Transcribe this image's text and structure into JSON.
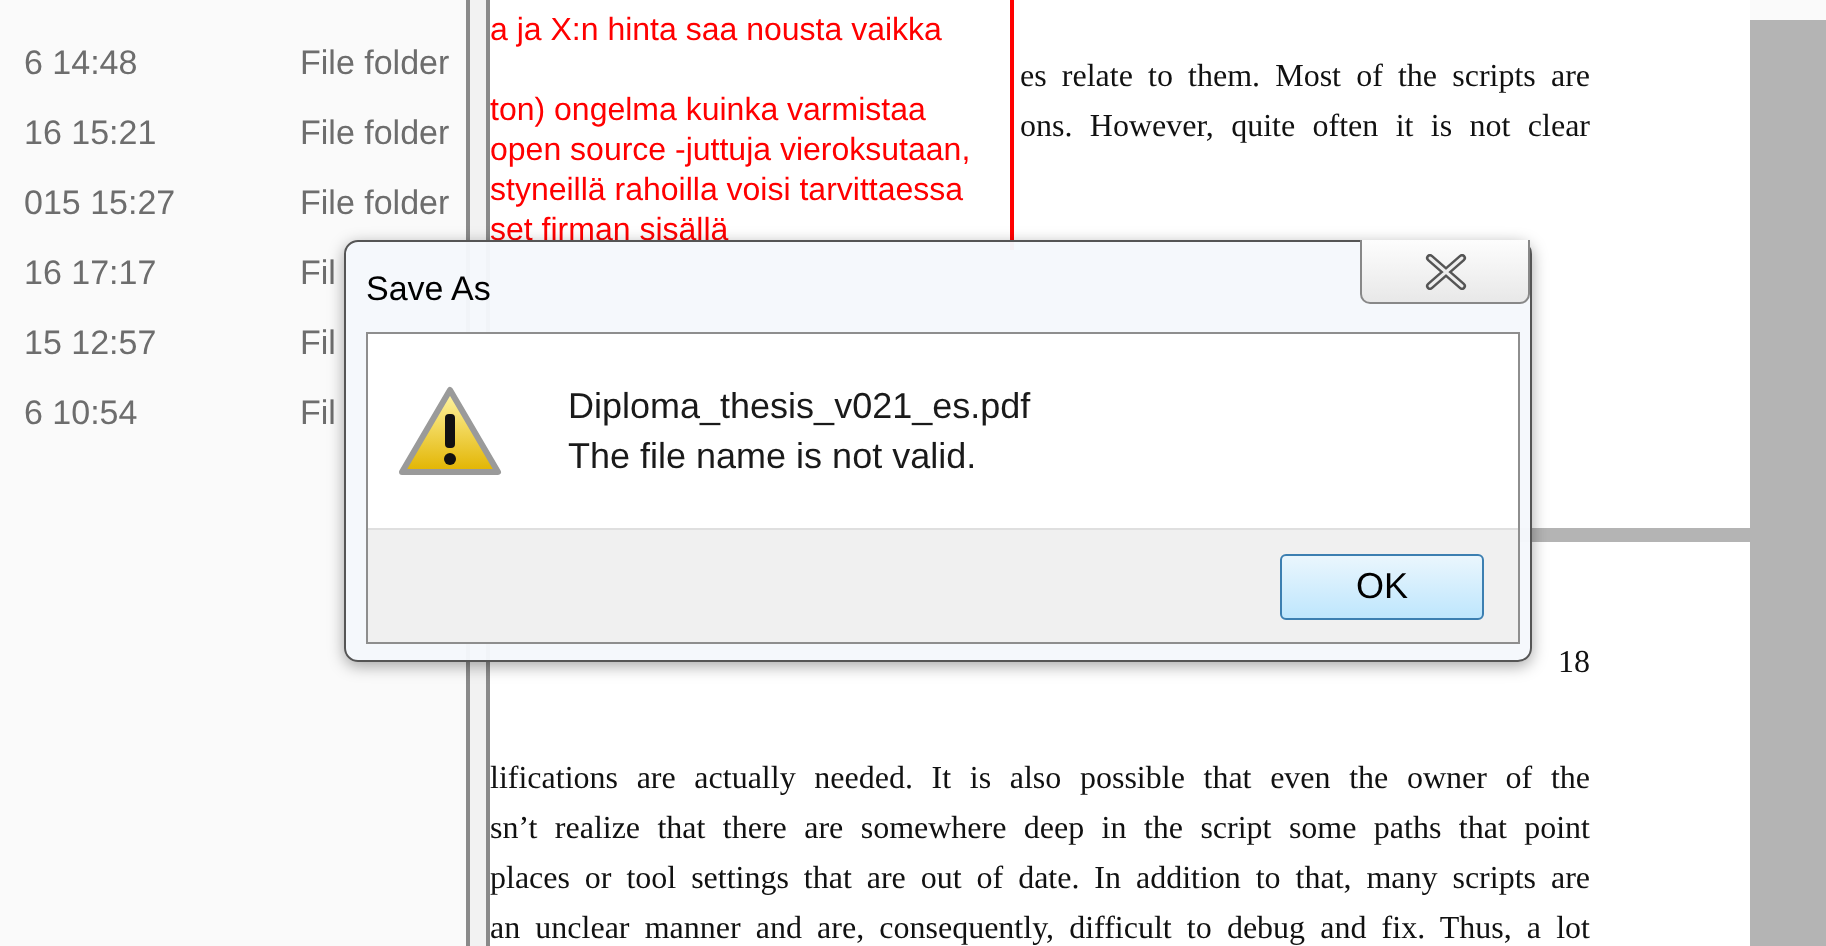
{
  "file_list": {
    "rows": [
      {
        "date_modified": "6 14:48",
        "type": "File folder"
      },
      {
        "date_modified": "16 15:21",
        "type": "File folder"
      },
      {
        "date_modified": "015 15:27",
        "type": "File folder"
      },
      {
        "date_modified": "16 17:17",
        "type": "Fil"
      },
      {
        "date_modified": "15 12:57",
        "type": "Fil"
      },
      {
        "date_modified": "6 10:54",
        "type": "Fil"
      }
    ]
  },
  "document": {
    "comment_lines": [
      "a ja X:n hinta saa nousta vaikka",
      "ton) ongelma kuinka varmistaa",
      "open source -juttuja vieroksutaan,",
      "styneillä rahoilla voisi tarvittaessa",
      "set firman sisällä"
    ],
    "top_lines": [
      "es relate to them.  Most of the scripts are",
      "ons.  However, quite often it is not clear"
    ],
    "page_number": "18",
    "body_lines": [
      "lifications are actually needed.  It is also possible that even the owner of the",
      "sn’t realize that there are somewhere deep in the script some paths that point",
      "places or tool settings that are out of date.  In addition to that, many scripts are",
      "an unclear manner and are, consequently, difficult to debug and fix.  Thus, a lot"
    ]
  },
  "dialog": {
    "title": "Save As",
    "file_name": "Diploma_thesis_v021_es.pdf",
    "message": "The file name is not valid.",
    "buttons": [
      "OK"
    ]
  }
}
